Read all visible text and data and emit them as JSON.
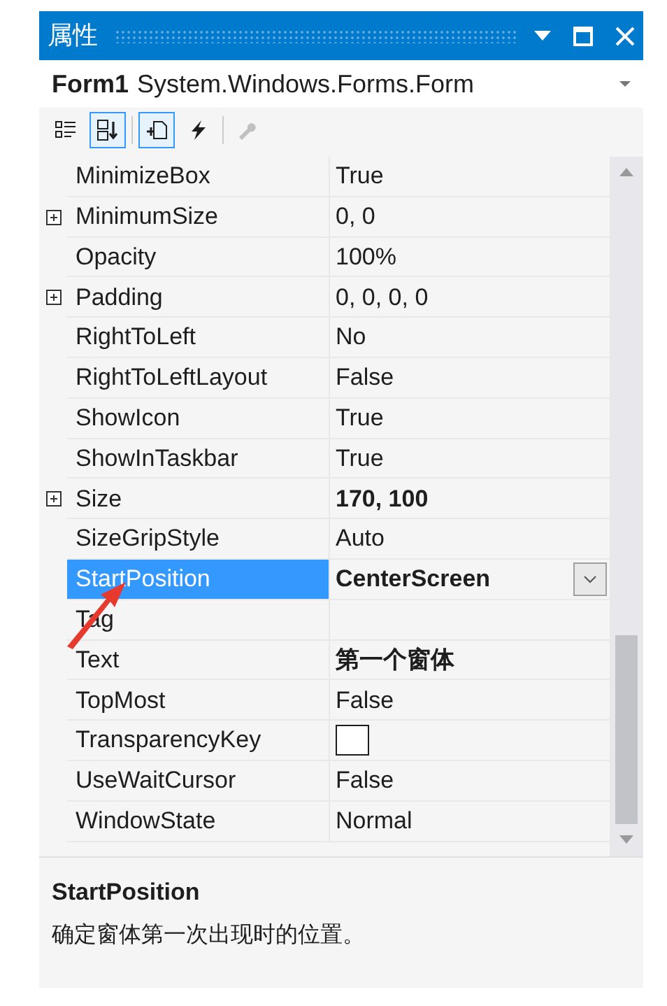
{
  "window": {
    "title": "属性"
  },
  "object_selector": {
    "name": "Form1",
    "type": "System.Windows.Forms.Form"
  },
  "toolbar": [
    {
      "kind": "categorized",
      "selected": false,
      "disabled": false
    },
    {
      "kind": "alphabetical",
      "selected": true,
      "disabled": false
    },
    {
      "kind": "properties",
      "selected": true,
      "disabled": false
    },
    {
      "kind": "events",
      "selected": false,
      "disabled": false
    },
    {
      "kind": "property-pages",
      "selected": false,
      "disabled": true
    }
  ],
  "properties": [
    {
      "name": "MinimizeBox",
      "value": "True",
      "kind": "text",
      "expandable": false,
      "bold": false,
      "selected": false
    },
    {
      "name": "MinimumSize",
      "value": "0, 0",
      "kind": "text",
      "expandable": true,
      "bold": false,
      "selected": false
    },
    {
      "name": "Opacity",
      "value": "100%",
      "kind": "text",
      "expandable": false,
      "bold": false,
      "selected": false
    },
    {
      "name": "Padding",
      "value": "0, 0, 0, 0",
      "kind": "text",
      "expandable": true,
      "bold": false,
      "selected": false
    },
    {
      "name": "RightToLeft",
      "value": "No",
      "kind": "text",
      "expandable": false,
      "bold": false,
      "selected": false
    },
    {
      "name": "RightToLeftLayout",
      "value": "False",
      "kind": "text",
      "expandable": false,
      "bold": false,
      "selected": false
    },
    {
      "name": "ShowIcon",
      "value": "True",
      "kind": "text",
      "expandable": false,
      "bold": false,
      "selected": false
    },
    {
      "name": "ShowInTaskbar",
      "value": "True",
      "kind": "text",
      "expandable": false,
      "bold": false,
      "selected": false
    },
    {
      "name": "Size",
      "value": "170, 100",
      "kind": "text",
      "expandable": true,
      "bold": true,
      "selected": false
    },
    {
      "name": "SizeGripStyle",
      "value": "Auto",
      "kind": "text",
      "expandable": false,
      "bold": false,
      "selected": false
    },
    {
      "name": "StartPosition",
      "value": "CenterScreen",
      "kind": "dropdown",
      "expandable": false,
      "bold": true,
      "selected": true
    },
    {
      "name": "Tag",
      "kind": "text",
      "expandable": false,
      "selected": false
    },
    {
      "name": "Text",
      "value": "第一个窗体",
      "kind": "text",
      "expandable": false,
      "bold": true,
      "selected": false
    },
    {
      "name": "TopMost",
      "value": "False",
      "kind": "text",
      "expandable": false,
      "bold": false,
      "selected": false
    },
    {
      "name": "TransparencyKey",
      "kind": "swatch",
      "color": "#ffffff",
      "expandable": false,
      "selected": false
    },
    {
      "name": "UseWaitCursor",
      "value": "False",
      "kind": "text",
      "expandable": false,
      "bold": false,
      "selected": false
    },
    {
      "name": "WindowState",
      "value": "Normal",
      "kind": "text",
      "expandable": false,
      "bold": false,
      "selected": false
    }
  ],
  "description": {
    "title": "StartPosition",
    "text": "确定窗体第一次出现时的位置。"
  }
}
